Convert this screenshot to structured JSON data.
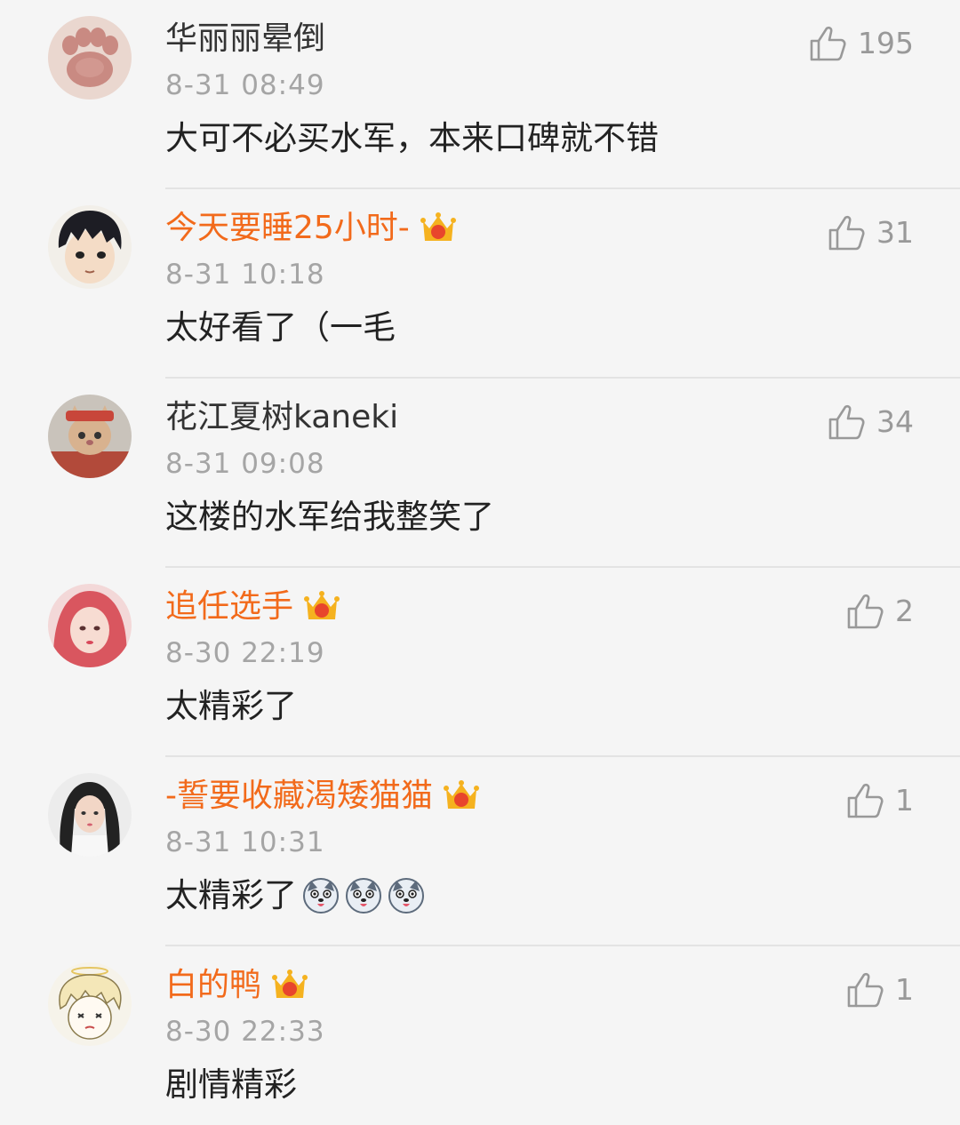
{
  "comments": [
    {
      "username": "华丽丽晕倒",
      "vip": false,
      "time": "8-31 08:49",
      "text": "大可不必买水军，本来口碑就不错",
      "likes": "195",
      "avatar_icon": "cat-paw-avatar",
      "emojis": []
    },
    {
      "username": "今天要睡25小时-",
      "vip": true,
      "time": "8-31 10:18",
      "text": "太好看了（一毛",
      "likes": "31",
      "avatar_icon": "anime-boy-avatar",
      "emojis": []
    },
    {
      "username": "花江夏树kaneki",
      "vip": false,
      "time": "8-31 09:08",
      "text": "这楼的水军给我整笑了",
      "likes": "34",
      "avatar_icon": "cat-costume-avatar",
      "emojis": []
    },
    {
      "username": "追任选手",
      "vip": true,
      "time": "8-30 22:19",
      "text": "太精彩了",
      "likes": "2",
      "avatar_icon": "girl-red-hair-avatar",
      "emojis": []
    },
    {
      "username": "-誓要收藏渴矮猫猫",
      "vip": true,
      "time": "8-31 10:31",
      "text": "太精彩了",
      "likes": "1",
      "avatar_icon": "girl-portrait-avatar",
      "emojis": [
        "husky-emoji",
        "husky-emoji",
        "husky-emoji"
      ]
    },
    {
      "username": "白的鸭",
      "vip": true,
      "time": "8-30 22:33",
      "text": "剧情精彩",
      "likes": "1",
      "avatar_icon": "sketch-boy-avatar",
      "emojis": []
    }
  ],
  "colors": {
    "vip_name": "#f26a1b",
    "normal_name": "#333333",
    "timestamp": "#a5a5a5",
    "like": "#999999",
    "crown_gold": "#f5b21f",
    "background": "#f5f5f5"
  },
  "icons": {
    "like": "thumbs-up-icon",
    "vip_badge": "crown-icon"
  }
}
